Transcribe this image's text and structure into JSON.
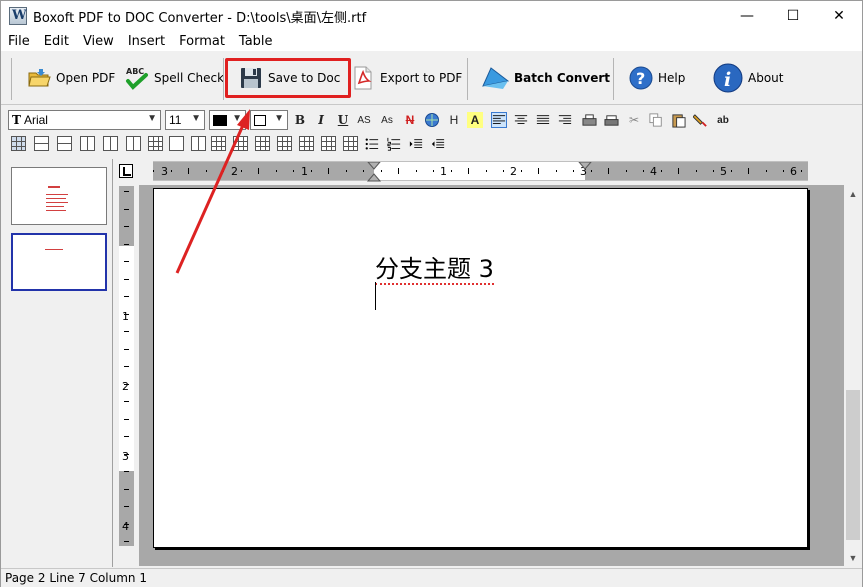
{
  "window": {
    "title": "Boxoft PDF to DOC Converter - D:\\tools\\桌面\\左侧.rtf",
    "minimize": "—",
    "maximize": "☐",
    "close": "✕"
  },
  "menu": [
    "File",
    "Edit",
    "View",
    "Insert",
    "Format",
    "Table"
  ],
  "toolbar": {
    "open_pdf": "Open PDF",
    "spell_check": "Spell Check",
    "save_to_doc": "Save to Doc",
    "export_to_pdf": "Export to PDF",
    "batch_convert": "Batch Convert",
    "help": "Help",
    "about": "About",
    "abc": "ABC"
  },
  "format": {
    "font_name": "Arial",
    "font_size": "11",
    "font_icon": "T",
    "bold": "B",
    "italic": "I",
    "underline": "U",
    "superscript": "AS",
    "subscript": "As",
    "strike": "N",
    "highlight": "H"
  },
  "ruler": {
    "h_numbers": [
      "3",
      "2",
      "1",
      "1",
      "2",
      "3",
      "4",
      "5",
      "6"
    ],
    "v_numbers": [
      "1",
      "2",
      "3",
      "4"
    ]
  },
  "document": {
    "text": "分支主题 3"
  },
  "status": {
    "text": "Page 2 Line 7 Column 1"
  },
  "colors": {
    "highlight_red": "#e02020",
    "accent_blue": "#2233aa"
  }
}
